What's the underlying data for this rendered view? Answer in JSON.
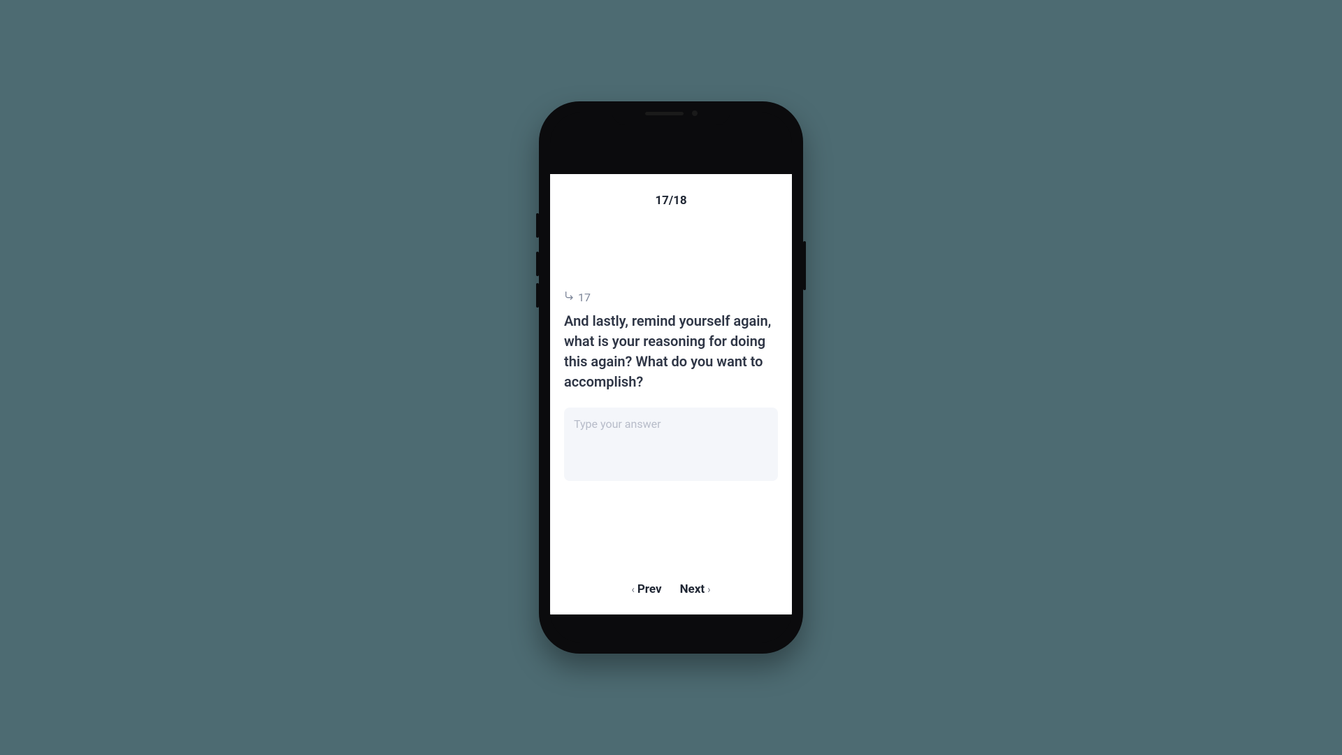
{
  "header": {
    "progress": "17/18"
  },
  "question": {
    "number": "17",
    "text": "And lastly, remind yourself again, what is your reasoning for doing this again? What do you want to accomplish?"
  },
  "answer": {
    "placeholder": "Type your answer"
  },
  "nav": {
    "prev": "Prev",
    "next": "Next"
  }
}
